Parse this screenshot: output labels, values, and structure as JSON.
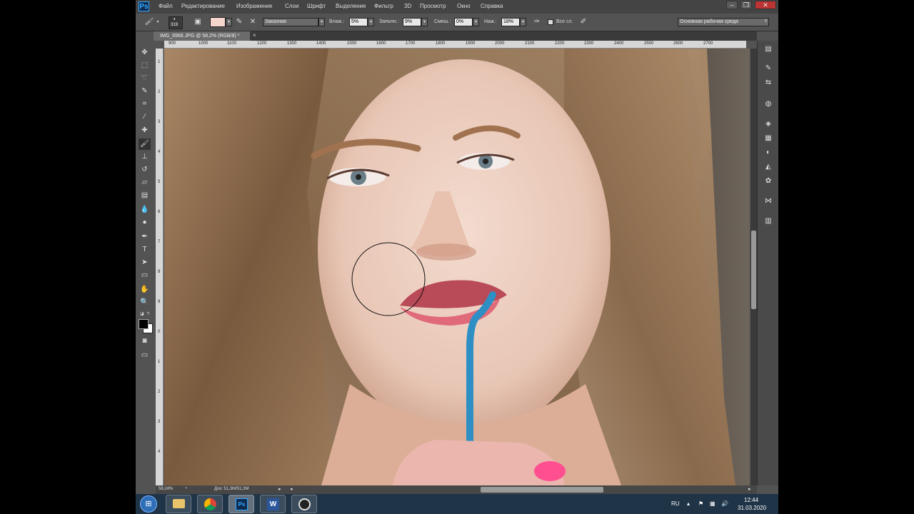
{
  "app": {
    "logo": "Ps",
    "menu": [
      "Файл",
      "Редактирование",
      "Изображение",
      "Слои",
      "Шрифт",
      "Выделение",
      "Фильтр",
      "3D",
      "Просмотр",
      "Окно",
      "Справка"
    ],
    "window_controls": [
      "minimize-icon",
      "restore-icon",
      "close-icon"
    ]
  },
  "options": {
    "brush_size": "319",
    "mode_value": "Заказная",
    "vlazh_label": "Влаж.:",
    "vlazh_value": "5%",
    "zapoln_label": "Заполн.:",
    "zapoln_value": "9%",
    "smesh_label": "Смеш.:",
    "smesh_value": "0%",
    "nazh_label": "Наж.:",
    "nazh_value": "18%",
    "all_layers_label": "Все сл.",
    "workspace_value": "Основная рабочая среда",
    "swatch_color": "#f5d5cc"
  },
  "document": {
    "tab_title": "IMG_6966.JPG @ 58,2% (RGB/8) *"
  },
  "ruler": {
    "h_labels": [
      "900",
      "1000",
      "1100",
      "1200",
      "1300",
      "1400",
      "1500",
      "1600",
      "1700",
      "1800",
      "1900",
      "2000",
      "2100",
      "2200",
      "2300",
      "2400",
      "2500",
      "2600",
      "2700"
    ],
    "v_labels": [
      "1",
      "2",
      "3",
      "4",
      "5",
      "6",
      "7",
      "8",
      "9",
      "0",
      "1",
      "2",
      "3",
      "4"
    ]
  },
  "status": {
    "zoom": "58,24%",
    "doc_info": "Док: 51,3M/51,3M"
  },
  "taskbar": {
    "lang": "RU",
    "time": "12:44",
    "date": "31.03.2020"
  }
}
